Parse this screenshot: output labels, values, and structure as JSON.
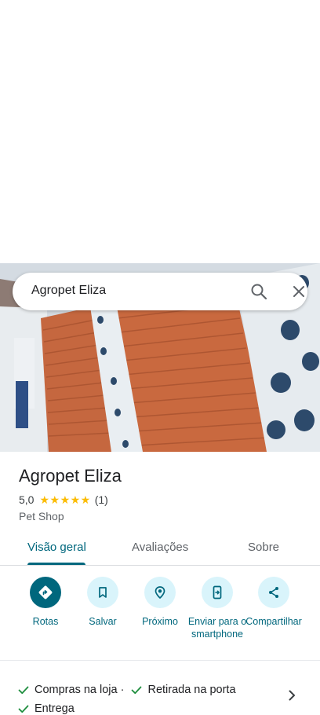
{
  "search": {
    "query": "Agropet Eliza"
  },
  "place": {
    "name": "Agropet Eliza",
    "rating": "5,0",
    "stars": "★★★★★",
    "review_count": "(1)",
    "category": "Pet Shop"
  },
  "tabs": [
    {
      "label": "Visão geral",
      "active": true
    },
    {
      "label": "Avaliações",
      "active": false
    },
    {
      "label": "Sobre",
      "active": false
    }
  ],
  "actions": [
    {
      "label": "Rotas",
      "icon": "directions-icon"
    },
    {
      "label": "Salvar",
      "icon": "bookmark-icon"
    },
    {
      "label": "Próximo",
      "icon": "nearby-icon"
    },
    {
      "label": "Enviar para o smartphone",
      "icon": "send-to-phone-icon"
    },
    {
      "label": "Compartilhar",
      "icon": "share-icon"
    }
  ],
  "amenities": {
    "item1": "Compras na loja ·",
    "item2": "Retirada na porta",
    "item3": "Entrega"
  },
  "colors": {
    "accent": "#00677d",
    "action_bg": "#d9f4fb",
    "star": "#fbbc04",
    "check": "#1e8e3e"
  }
}
